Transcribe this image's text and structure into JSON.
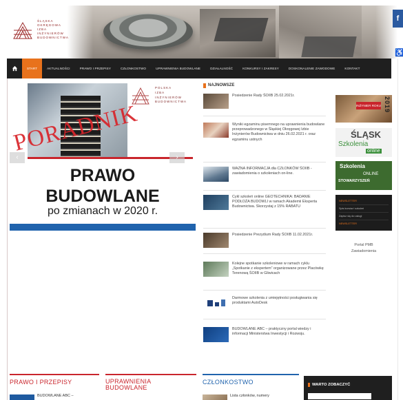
{
  "header": {
    "logo_text": [
      "ŚLĄSKA",
      "OKRĘGOWA",
      "IZBA",
      "INŻYNIERÓW",
      "BUDOWNICTWA"
    ],
    "facebook": "f",
    "accessibility_icon": "accessibility-icon"
  },
  "nav": {
    "home_icon": "home-icon",
    "items": [
      "Start",
      "Aktualności",
      "Prawo i przepisy",
      "Członkostwo",
      "Uprawnienia budowlane",
      "Działalność",
      "Konkursy i zakresy",
      "Doskonalenie zawodowe",
      "Kontakt"
    ],
    "active_index": 0
  },
  "slider": {
    "overlay_word": "PORADNIK",
    "logo_text": [
      "POLSKA",
      "IZBA",
      "INŻYNIERÓW",
      "BUDOWNICTWA"
    ],
    "title_line1": "PRAWO",
    "title_line2": "BUDOWLANE",
    "subtitle": "po zmianach w 2020 r.",
    "prev": "‹",
    "next": "›"
  },
  "news": {
    "heading": "NAJNOWSZE",
    "items": [
      {
        "text": "Posiedzenie Rady ŚOIIB 25.02.2021r.",
        "thumb_color": "#8a7a6a"
      },
      {
        "text": "Wyniki egzaminu pisemnego na uprawnienia budowlane przeprowadzonego w Śląskiej Okręgowej Izbie Inżynierów Budownictwa w dniu 26.02.2021 r. oraz egzaminu ustnych",
        "thumb_color": "#b06a4a"
      },
      {
        "text": "WAŻNA INFORMACJA dla CZŁONKÓW ŚOIIB - zawiadomienia o szkoleniach on-line.",
        "thumb_color": "#6a7f92"
      },
      {
        "text": "Cykl szkoleń online GEOTECHNIKA: BADANIE PODŁOŻA BUDOWLI w ramach Akademii Eksperta Budownictwa. Skorzystaj z 15% RABATU",
        "thumb_color": "#3e5e7e"
      },
      {
        "text": "Posiedzenie Prezydium Rady ŚOIIB 11.02.2021r.",
        "thumb_color": "#7f6a5a"
      },
      {
        "text": "Kolejne spotkanie szkoleniowe w ramach cyklu „Spotkanie z ekspertem” organizowane przez Placówkę Terenową ŚOIIB w Gliwicach",
        "thumb_color": "#6f8a6a"
      },
      {
        "text": "Darmowe szkolenia z umiejętności posługiwania się produktami AutoDesk",
        "thumb_color": "#2d4f86"
      },
      {
        "text": "BUDOWLANE ABC – praktyczny portal wiedzy i informacji Ministerstwa Inwestycji i Rozwoju.",
        "thumb_color": "#1e5aa0"
      }
    ]
  },
  "right": {
    "konkurs_tag": "INŻYNIER ROKU",
    "konkurs_year": "2019",
    "slask_big": "ŚLĄSK",
    "slask_sub1": "Szkolenia",
    "slask_sub2": "online",
    "stow_t1": "Szkolenia",
    "stow_t2": "ONLINE",
    "stow_t3": "STOWARZYSZEŃ",
    "newsletter": [
      "NEWSLETTER",
      "Spis kursów i szkoleń",
      "Zapisz się do usługi",
      "NEWSLETTER"
    ],
    "pmb_line1": "Portal PMB",
    "pmb_line2": "Zawiadomienia"
  },
  "bottom": {
    "prawo": "PRAWO I PRZEPISY",
    "prawo_teaser": "BUDOWLANE ABC –",
    "uprawnienia_line1": "UPRAWNIENIA",
    "uprawnienia_line2": "BUDOWLANE",
    "czlonkostwo": "CZŁONKOSTWO",
    "czlonkostwo_teaser": "Lista członków, numery",
    "warto": "WARTO ZOBACZYĆ"
  },
  "colors": {
    "accent": "#e8721c",
    "brand_red": "#c9252c",
    "brand_blue": "#2063ad",
    "nav_bg": "#1f1f1f"
  }
}
